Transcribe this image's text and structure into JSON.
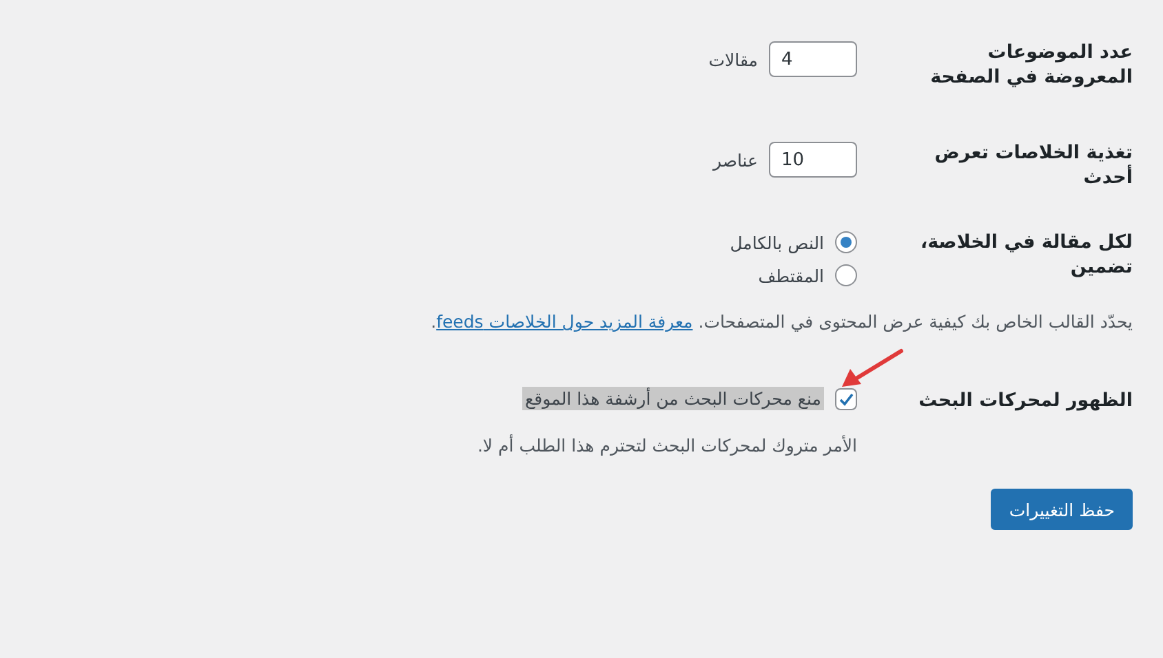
{
  "settings": [
    {
      "kind": "number",
      "label": "عدد الموضوعات المعروضة في الصفحة",
      "value": "4",
      "unit": "مقالات"
    },
    {
      "kind": "number",
      "label": "تغذية الخلاصات تعرض أحدث",
      "value": "10",
      "unit": "عناصر"
    },
    {
      "kind": "radio",
      "label": "لكل مقالة في الخلاصة، تضمين",
      "options": [
        {
          "label": "النص بالكامل",
          "selected": true
        },
        {
          "label": "المقتطف",
          "selected": false
        }
      ],
      "description": "يحدّد القالب الخاص بك كيفية عرض المحتوى في المتصفحات.",
      "link": "معرفة المزيد حول الخلاصات feeds",
      "link_suffix": "."
    },
    {
      "kind": "checkbox",
      "label": "الظهور لمحركات البحث",
      "option": "منع محركات البحث من أرشفة هذا الموقع",
      "checked": true,
      "highlighted": true,
      "annotated": true,
      "description": "الأمر متروك لمحركات البحث لتحترم هذا الطلب أم لا."
    }
  ],
  "save_button": "حفظ التغييرات"
}
